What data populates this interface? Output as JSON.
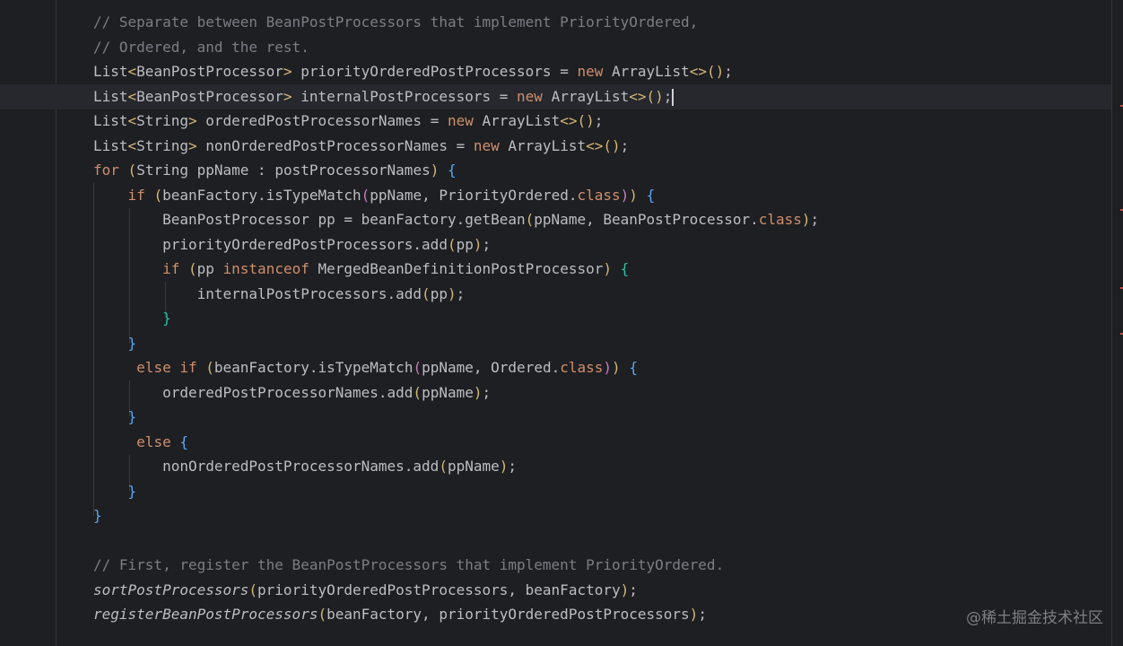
{
  "editor": {
    "language": "java",
    "lines": [
      [
        {
          "t": "// Separate between BeanPostProcessors that implement PriorityOrdered,",
          "c": "comment"
        }
      ],
      [
        {
          "t": "// Ordered, and the rest.",
          "c": "comment"
        }
      ],
      [
        {
          "t": "List"
        },
        {
          "t": "<",
          "c": "b1"
        },
        {
          "t": "BeanPostProcessor"
        },
        {
          "t": ">",
          "c": "b1"
        },
        {
          "t": " priorityOrderedPostProcessors = "
        },
        {
          "t": "new",
          "c": "keyword"
        },
        {
          "t": " ArrayList"
        },
        {
          "t": "<>",
          "c": "b1"
        },
        {
          "t": "()",
          "c": "b1"
        },
        {
          "t": ";"
        }
      ],
      [
        {
          "t": "List"
        },
        {
          "t": "<",
          "c": "b1"
        },
        {
          "t": "BeanPostProcessor"
        },
        {
          "t": ">",
          "c": "b1"
        },
        {
          "t": " internalPostProcessors = "
        },
        {
          "t": "new",
          "c": "keyword"
        },
        {
          "t": " ArrayList"
        },
        {
          "t": "<>",
          "c": "b1"
        },
        {
          "t": "()",
          "c": "b1"
        },
        {
          "t": ";"
        },
        {
          "caret": true
        }
      ],
      [
        {
          "t": "List"
        },
        {
          "t": "<",
          "c": "b1"
        },
        {
          "t": "String"
        },
        {
          "t": ">",
          "c": "b1"
        },
        {
          "t": " orderedPostProcessorNames = "
        },
        {
          "t": "new",
          "c": "keyword"
        },
        {
          "t": " ArrayList"
        },
        {
          "t": "<>",
          "c": "b1"
        },
        {
          "t": "()",
          "c": "b1"
        },
        {
          "t": ";"
        }
      ],
      [
        {
          "t": "List"
        },
        {
          "t": "<",
          "c": "b1"
        },
        {
          "t": "String"
        },
        {
          "t": ">",
          "c": "b1"
        },
        {
          "t": " nonOrderedPostProcessorNames = "
        },
        {
          "t": "new",
          "c": "keyword"
        },
        {
          "t": " ArrayList"
        },
        {
          "t": "<>",
          "c": "b1"
        },
        {
          "t": "()",
          "c": "b1"
        },
        {
          "t": ";"
        }
      ],
      [
        {
          "t": "for",
          "c": "keyword"
        },
        {
          "t": " "
        },
        {
          "t": "(",
          "c": "b1"
        },
        {
          "t": "String ppName : postProcessorNames"
        },
        {
          "t": ")",
          "c": "b1"
        },
        {
          "t": " "
        },
        {
          "t": "{",
          "c": "b3"
        }
      ],
      [
        {
          "t": "    "
        },
        {
          "t": "if",
          "c": "keyword"
        },
        {
          "t": " "
        },
        {
          "t": "(",
          "c": "b1"
        },
        {
          "t": "beanFactory.isTypeMatch"
        },
        {
          "t": "(",
          "c": "b2"
        },
        {
          "t": "ppName, PriorityOrdered."
        },
        {
          "t": "class",
          "c": "keyword"
        },
        {
          "t": ")",
          "c": "b2"
        },
        {
          "t": ")",
          "c": "b1"
        },
        {
          "t": " "
        },
        {
          "t": "{",
          "c": "b3"
        }
      ],
      [
        {
          "t": "        BeanPostProcessor pp = beanFactory.getBean"
        },
        {
          "t": "(",
          "c": "b1"
        },
        {
          "t": "ppName, BeanPostProcessor."
        },
        {
          "t": "class",
          "c": "keyword"
        },
        {
          "t": ")",
          "c": "b1"
        },
        {
          "t": ";"
        }
      ],
      [
        {
          "t": "        priorityOrderedPostProcessors.add"
        },
        {
          "t": "(",
          "c": "b1"
        },
        {
          "t": "pp"
        },
        {
          "t": ")",
          "c": "b1"
        },
        {
          "t": ";"
        }
      ],
      [
        {
          "t": "        "
        },
        {
          "t": "if",
          "c": "keyword"
        },
        {
          "t": " "
        },
        {
          "t": "(",
          "c": "b1"
        },
        {
          "t": "pp "
        },
        {
          "t": "instanceof",
          "c": "keyword"
        },
        {
          "t": " MergedBeanDefinitionPostProcessor"
        },
        {
          "t": ")",
          "c": "b1"
        },
        {
          "t": " "
        },
        {
          "t": "{",
          "c": "b4"
        }
      ],
      [
        {
          "t": "            internalPostProcessors.add"
        },
        {
          "t": "(",
          "c": "b1"
        },
        {
          "t": "pp"
        },
        {
          "t": ")",
          "c": "b1"
        },
        {
          "t": ";"
        }
      ],
      [
        {
          "t": "        "
        },
        {
          "t": "}",
          "c": "b4"
        }
      ],
      [
        {
          "t": "    "
        },
        {
          "t": "}",
          "c": "b3"
        }
      ],
      [
        {
          "t": "     "
        },
        {
          "t": "else if",
          "c": "keyword"
        },
        {
          "t": " "
        },
        {
          "t": "(",
          "c": "b1"
        },
        {
          "t": "beanFactory.isTypeMatch"
        },
        {
          "t": "(",
          "c": "b2"
        },
        {
          "t": "ppName, Ordered."
        },
        {
          "t": "class",
          "c": "keyword"
        },
        {
          "t": ")",
          "c": "b2"
        },
        {
          "t": ")",
          "c": "b1"
        },
        {
          "t": " "
        },
        {
          "t": "{",
          "c": "b3"
        }
      ],
      [
        {
          "t": "        orderedPostProcessorNames.add"
        },
        {
          "t": "(",
          "c": "b1"
        },
        {
          "t": "ppName"
        },
        {
          "t": ")",
          "c": "b1"
        },
        {
          "t": ";"
        }
      ],
      [
        {
          "t": "    "
        },
        {
          "t": "}",
          "c": "b3"
        }
      ],
      [
        {
          "t": "     "
        },
        {
          "t": "else",
          "c": "keyword"
        },
        {
          "t": " "
        },
        {
          "t": "{",
          "c": "b3"
        }
      ],
      [
        {
          "t": "        nonOrderedPostProcessorNames.add"
        },
        {
          "t": "(",
          "c": "b1"
        },
        {
          "t": "ppName"
        },
        {
          "t": ")",
          "c": "b1"
        },
        {
          "t": ";"
        }
      ],
      [
        {
          "t": "    "
        },
        {
          "t": "}",
          "c": "b3"
        }
      ],
      [
        {
          "t": "}",
          "c": "b3"
        }
      ],
      [],
      [
        {
          "t": "// First, register the BeanPostProcessors that implement PriorityOrdered.",
          "c": "comment"
        }
      ],
      [
        {
          "t": "sortPostProcessors",
          "c": "italic"
        },
        {
          "t": "(",
          "c": "b1"
        },
        {
          "t": "priorityOrderedPostProcessors, beanFactory"
        },
        {
          "t": ")",
          "c": "b1"
        },
        {
          "t": ";"
        }
      ],
      [
        {
          "t": "registerBeanPostProcessors",
          "c": "italic"
        },
        {
          "t": "(",
          "c": "b1"
        },
        {
          "t": "beanFactory, priorityOrderedPostProcessors"
        },
        {
          "t": ")",
          "c": "b1"
        },
        {
          "t": ";"
        }
      ]
    ]
  },
  "watermark": "@稀土掘金技术社区",
  "colors": {
    "background": "#1e1f22",
    "text": "#bcbec4",
    "comment": "#7a7e85",
    "keyword": "#cf8e6d",
    "bracket_1": "#d5b778",
    "bracket_2": "#c77dbb",
    "bracket_3": "#56a8f5",
    "bracket_4": "#2fbfa5",
    "caret_line": "#26282e",
    "error_stripe": "#c94f4f"
  }
}
